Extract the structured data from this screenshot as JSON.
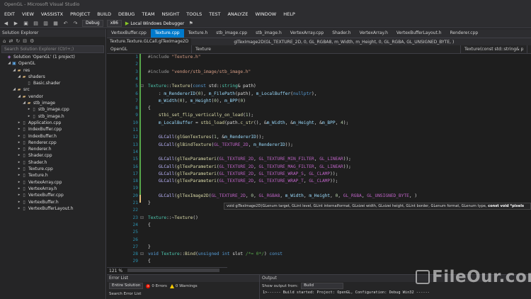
{
  "window": {
    "title": "OpenGL - Microsoft Visual Studio"
  },
  "menu": [
    "EDIT",
    "VIEW",
    "VASSISTX",
    "PROJECT",
    "BUILD",
    "DEBUG",
    "TEAM",
    "NSIGHT",
    "TOOLS",
    "TEST",
    "ANALYZE",
    "WINDOW",
    "HELP"
  ],
  "toolbar": {
    "config": "Debug",
    "platform": "x86",
    "run_label": "Local Windows Debugger"
  },
  "solution_explorer": {
    "title": "Solution Explorer",
    "search_placeholder": "Search Solution Explorer (Ctrl+;)",
    "items": [
      {
        "label": "Solution 'OpenGL' (1 project)",
        "icon": "solution-icon",
        "indent": 0,
        "chev": ""
      },
      {
        "label": "OpenGL",
        "icon": "project-icon",
        "indent": 1,
        "chev": "◢"
      },
      {
        "label": "res",
        "icon": "folder-icon",
        "indent": 2,
        "chev": "◢"
      },
      {
        "label": "shaders",
        "icon": "folder-icon",
        "indent": 3,
        "chev": "◢"
      },
      {
        "label": "Basic.shader",
        "icon": "file-icon",
        "indent": 4,
        "chev": ""
      },
      {
        "label": "src",
        "icon": "folder-icon",
        "indent": 2,
        "chev": "◢"
      },
      {
        "label": "vendor",
        "icon": "folder-icon",
        "indent": 3,
        "chev": "◢"
      },
      {
        "label": "stb_image",
        "icon": "folder-icon",
        "indent": 4,
        "chev": "◢"
      },
      {
        "label": "stb_image.cpp",
        "icon": "cpp-icon",
        "indent": 5,
        "chev": "▸"
      },
      {
        "label": "stb_image.h",
        "icon": "header-icon",
        "indent": 5,
        "chev": "▸"
      },
      {
        "label": "Application.cpp",
        "icon": "cpp-icon",
        "indent": 3,
        "chev": "▸"
      },
      {
        "label": "IndexBuffer.cpp",
        "icon": "cpp-icon",
        "indent": 3,
        "chev": "▸"
      },
      {
        "label": "IndexBuffer.h",
        "icon": "header-icon",
        "indent": 3,
        "chev": "▸"
      },
      {
        "label": "Renderer.cpp",
        "icon": "cpp-icon",
        "indent": 3,
        "chev": "▸"
      },
      {
        "label": "Renderer.h",
        "icon": "header-icon",
        "indent": 3,
        "chev": "▸"
      },
      {
        "label": "Shader.cpp",
        "icon": "cpp-icon",
        "indent": 3,
        "chev": "▸"
      },
      {
        "label": "Shader.h",
        "icon": "header-icon",
        "indent": 3,
        "chev": "▸"
      },
      {
        "label": "Texture.cpp",
        "icon": "cpp-icon",
        "indent": 3,
        "chev": "▸"
      },
      {
        "label": "Texture.h",
        "icon": "header-icon",
        "indent": 3,
        "chev": "▸"
      },
      {
        "label": "VertexArray.cpp",
        "icon": "cpp-icon",
        "indent": 3,
        "chev": "▸"
      },
      {
        "label": "VertexArray.h",
        "icon": "header-icon",
        "indent": 3,
        "chev": "▸"
      },
      {
        "label": "VertexBuffer.cpp",
        "icon": "cpp-icon",
        "indent": 3,
        "chev": "▸"
      },
      {
        "label": "VertexBuffer.h",
        "icon": "header-icon",
        "indent": 3,
        "chev": "▸"
      },
      {
        "label": "VertexBufferLayout.h",
        "icon": "header-icon",
        "indent": 3,
        "chev": "▸"
      }
    ]
  },
  "tabs": [
    {
      "label": "VertexBuffer.cpp",
      "active": false
    },
    {
      "label": "Texture.cpp",
      "active": true
    },
    {
      "label": "Texture.h",
      "active": false
    },
    {
      "label": "stb_image.cpp",
      "active": false
    },
    {
      "label": "stb_image.h",
      "active": false
    },
    {
      "label": "VertexArray.cpp",
      "active": false
    },
    {
      "label": "Shader.h",
      "active": false
    },
    {
      "label": "VertexArray.h",
      "active": false
    },
    {
      "label": "VertexBufferLayout.h",
      "active": false
    },
    {
      "label": "Renderer.cpp",
      "active": false
    }
  ],
  "breadcrumb": {
    "file": "Texture.Texture.GLCall.glTexImage2D",
    "member": "glTexImage2D(GL_TEXTURE_2D, 0, GL_RGBA8, m_Width, m_Height, 0, GL_RGBA, GL_UNSIGNED_BYTE, )",
    "project": "OpenGL",
    "scope": "Texture",
    "function": "Texture(const std::string& p"
  },
  "editor": {
    "line_numbers": [
      "1",
      "2",
      "3",
      "4",
      "5",
      "6",
      "7",
      "8",
      "9",
      "10",
      "11",
      "12",
      "13",
      "14",
      "15",
      "16",
      "17",
      "18",
      "19",
      "20",
      "21",
      "22",
      "23",
      "24",
      "25",
      "26",
      "27",
      "28",
      "29"
    ],
    "tooltip_prefix": "void glTexImage2D(GLenum target, GLint level, GLint internalformat, GLsizei width, GLsizei height, GLint border, GLenum format, GLenum type, ",
    "tooltip_bold": "const void *pixels"
  },
  "zoom": "121 %",
  "error_list": {
    "title": "Error List",
    "scope": "Entire Solution",
    "errors": "0 Errors",
    "warnings": "0 Warnings",
    "search_placeholder": "Search Error List"
  },
  "output": {
    "title": "Output",
    "show_from_label": "Show output from:",
    "source": "Build",
    "line": "1>------ Build started: Project: OpenGL, Configuration: Debug Win32 ------"
  },
  "watermark": "FileOur.com",
  "colors": {
    "accent": "#007acc",
    "background": "#1e1e1e",
    "panel": "#252526"
  }
}
